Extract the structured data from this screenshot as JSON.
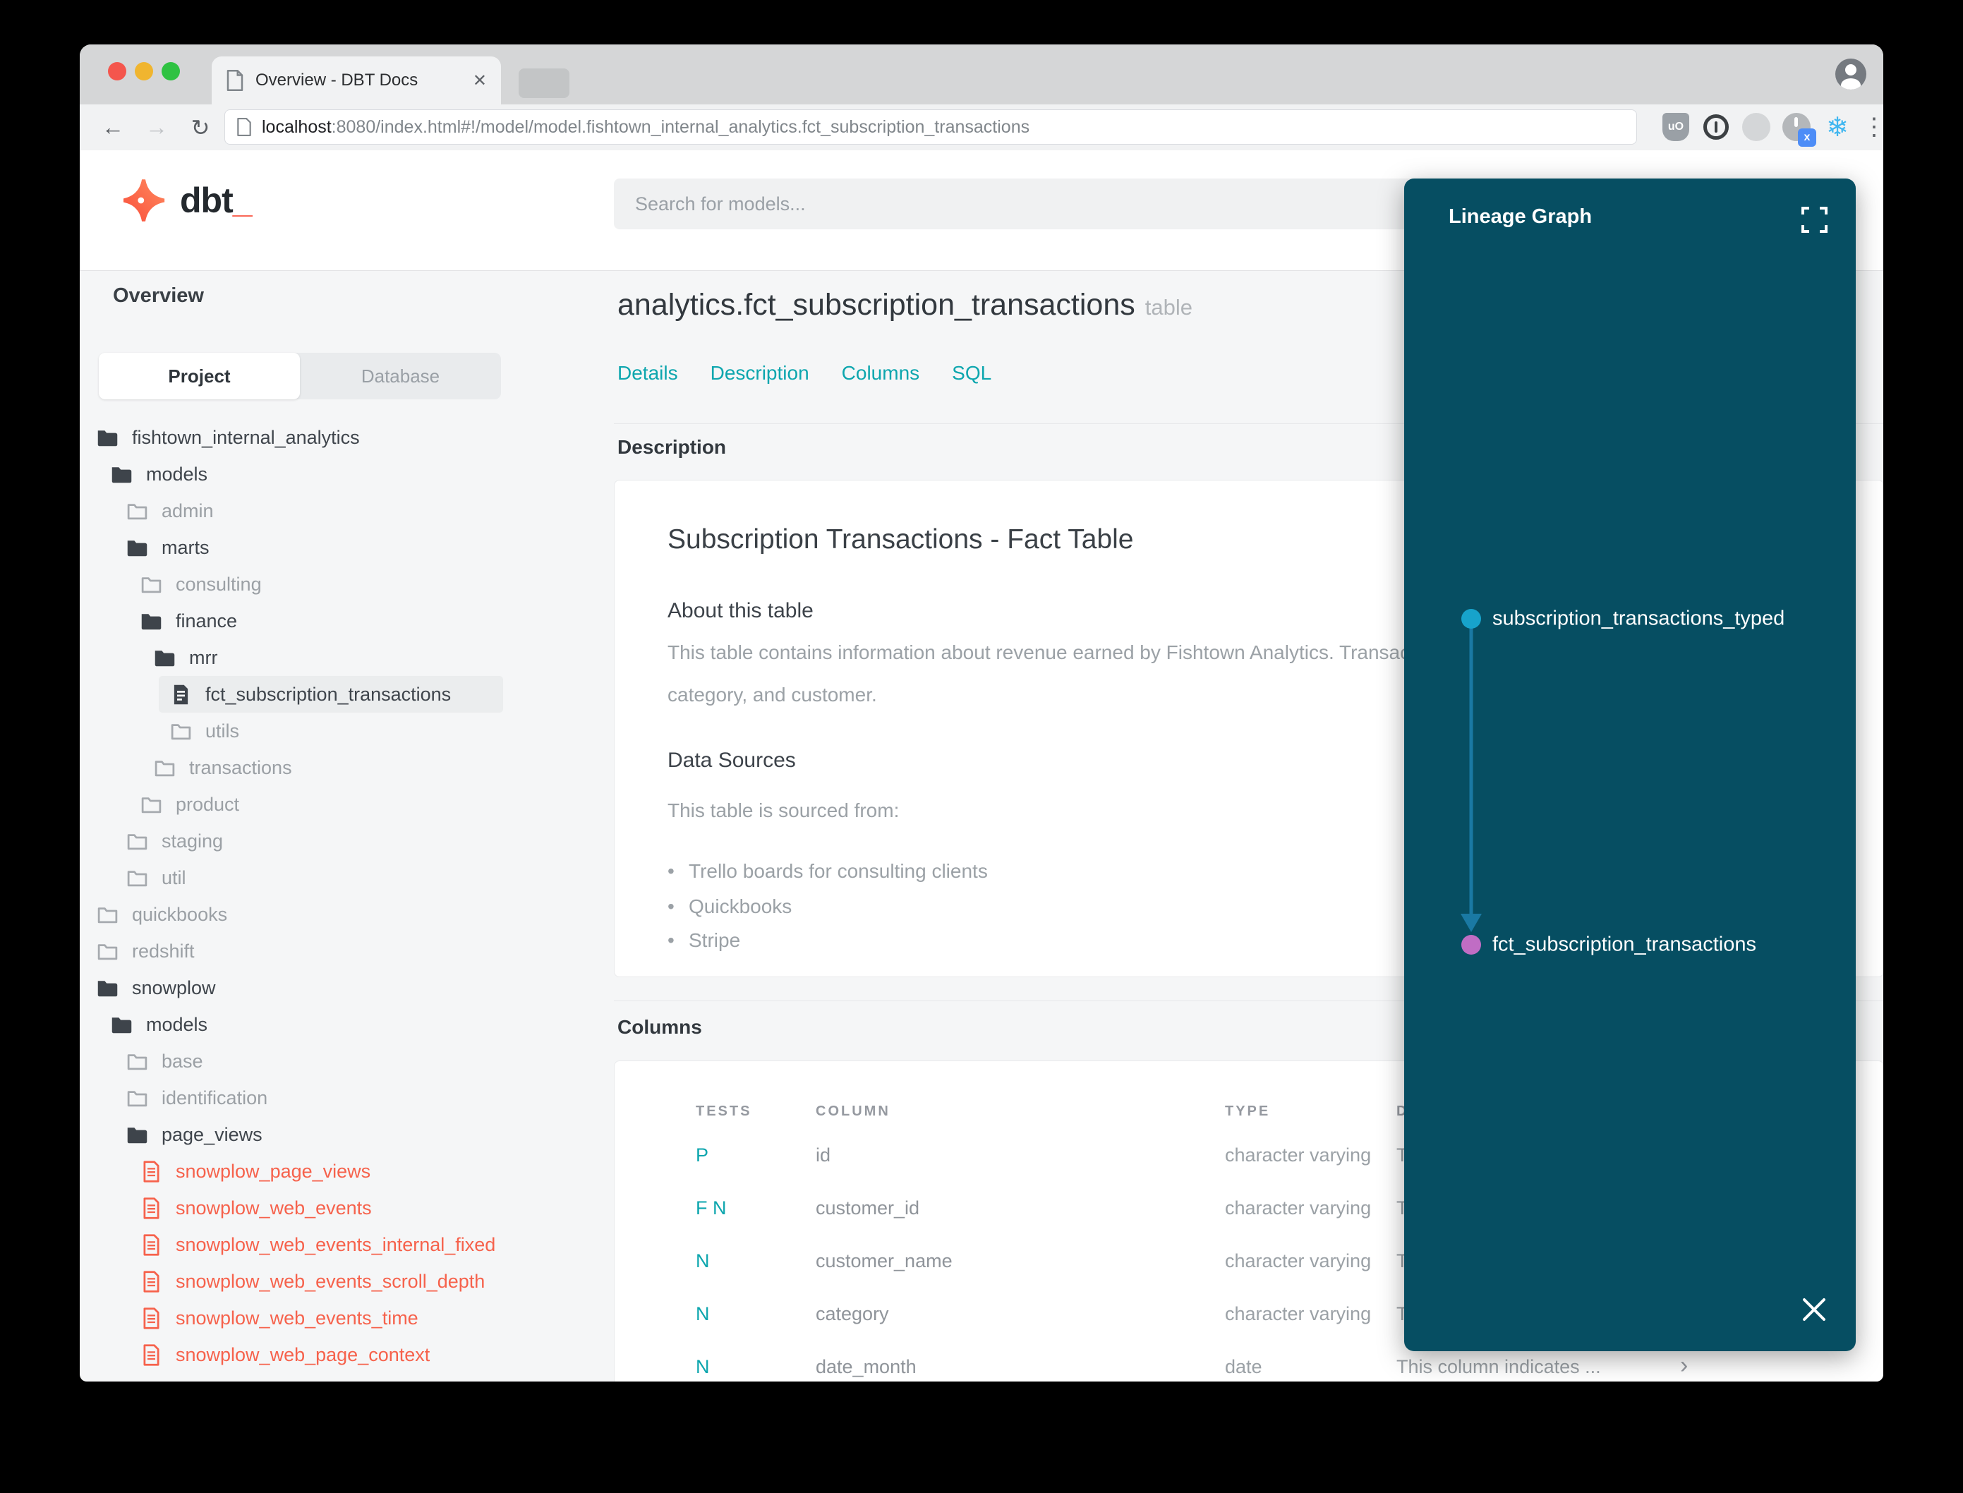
{
  "browser": {
    "tab_title": "Overview - DBT Docs",
    "tab_close": "✕",
    "back": "←",
    "forward": "→",
    "reload": "↻",
    "url_host": "localhost",
    "url_rest": ":8080/index.html#!/model/model.fishtown_internal_analytics.fct_subscription_transactions",
    "ublock_label": "uO",
    "power_badge": "x",
    "snowflake": "❄",
    "menu_dots": "⋮"
  },
  "header": {
    "logo_text": "dbt",
    "logo_underscore": "_",
    "search_placeholder": "Search for models..."
  },
  "sidebar": {
    "overview_label": "Overview",
    "tabs": {
      "project": "Project",
      "database": "Database"
    },
    "tree": [
      {
        "label": "fishtown_internal_analytics",
        "icon": "folder-open-icon"
      },
      {
        "label": "models",
        "icon": "folder-open-icon"
      },
      {
        "label": "admin",
        "icon": "folder-icon"
      },
      {
        "label": "marts",
        "icon": "folder-open-icon"
      },
      {
        "label": "consulting",
        "icon": "folder-icon"
      },
      {
        "label": "finance",
        "icon": "folder-open-icon"
      },
      {
        "label": "mrr",
        "icon": "folder-open-icon"
      },
      {
        "label": "fct_subscription_transactions",
        "icon": "file-icon",
        "selected": true
      },
      {
        "label": "utils",
        "icon": "folder-icon"
      },
      {
        "label": "transactions",
        "icon": "folder-icon"
      },
      {
        "label": "product",
        "icon": "folder-icon"
      },
      {
        "label": "staging",
        "icon": "folder-icon"
      },
      {
        "label": "util",
        "icon": "folder-icon"
      },
      {
        "label": "quickbooks",
        "icon": "folder-icon"
      },
      {
        "label": "redshift",
        "icon": "folder-icon"
      },
      {
        "label": "snowplow",
        "icon": "folder-open-icon"
      },
      {
        "label": "models",
        "icon": "folder-open-icon"
      },
      {
        "label": "base",
        "icon": "folder-icon"
      },
      {
        "label": "identification",
        "icon": "folder-icon"
      },
      {
        "label": "page_views",
        "icon": "folder-open-icon"
      },
      {
        "label": "snowplow_page_views",
        "icon": "file-icon"
      },
      {
        "label": "snowplow_web_events",
        "icon": "file-icon"
      },
      {
        "label": "snowplow_web_events_internal_fixed",
        "icon": "file-icon"
      },
      {
        "label": "snowplow_web_events_scroll_depth",
        "icon": "file-icon"
      },
      {
        "label": "snowplow_web_events_time",
        "icon": "file-icon"
      },
      {
        "label": "snowplow_web_page_context",
        "icon": "file-icon"
      }
    ]
  },
  "main": {
    "title": "analytics.fct_subscription_transactions",
    "title_badge": "table",
    "tabs": [
      "Details",
      "Description",
      "Columns",
      "SQL"
    ],
    "description_section": "Description",
    "doc": {
      "h1": "Subscription Transactions - Fact Table",
      "about_h2": "About this table",
      "about_p_line1": "This table contains information about revenue earned by Fishtown Analytics. Transactions are grouped by type,",
      "about_p_line2": "category, and customer.",
      "sources_h2": "Data Sources",
      "sources_intro": "This table is sourced from:",
      "sources": [
        "Trello boards for consulting clients",
        "Quickbooks",
        "Stripe"
      ]
    },
    "columns_section": "Columns",
    "table": {
      "headers": [
        "TESTS",
        "COLUMN",
        "TYPE",
        "DESCRIPTION"
      ],
      "rows": [
        {
          "tests": "P",
          "column": "id",
          "type": "character varying",
          "desc": "T"
        },
        {
          "tests": "F N",
          "column": "customer_id",
          "type": "character varying",
          "desc": "T"
        },
        {
          "tests": "N",
          "column": "customer_name",
          "type": "character varying",
          "desc": "T"
        },
        {
          "tests": "N",
          "column": "category",
          "type": "character varying",
          "desc": "T"
        },
        {
          "tests": "N",
          "column": "date_month",
          "type": "date",
          "desc": "This column indicates ...",
          "chevron": "›"
        }
      ]
    }
  },
  "lineage": {
    "title": "Lineage Graph",
    "nodes": [
      {
        "label": "subscription_transactions_typed",
        "color": "#17a3cb"
      },
      {
        "label": "fct_subscription_transactions",
        "color": "#c06dc4"
      }
    ],
    "arrow_color": "#1a79a3",
    "panel_color": "#064e62",
    "close": "✕"
  },
  "colors": {
    "accent_teal": "#0da6ae",
    "brand_orange": "#f6624c",
    "page_bg": "#f5f6f7"
  }
}
